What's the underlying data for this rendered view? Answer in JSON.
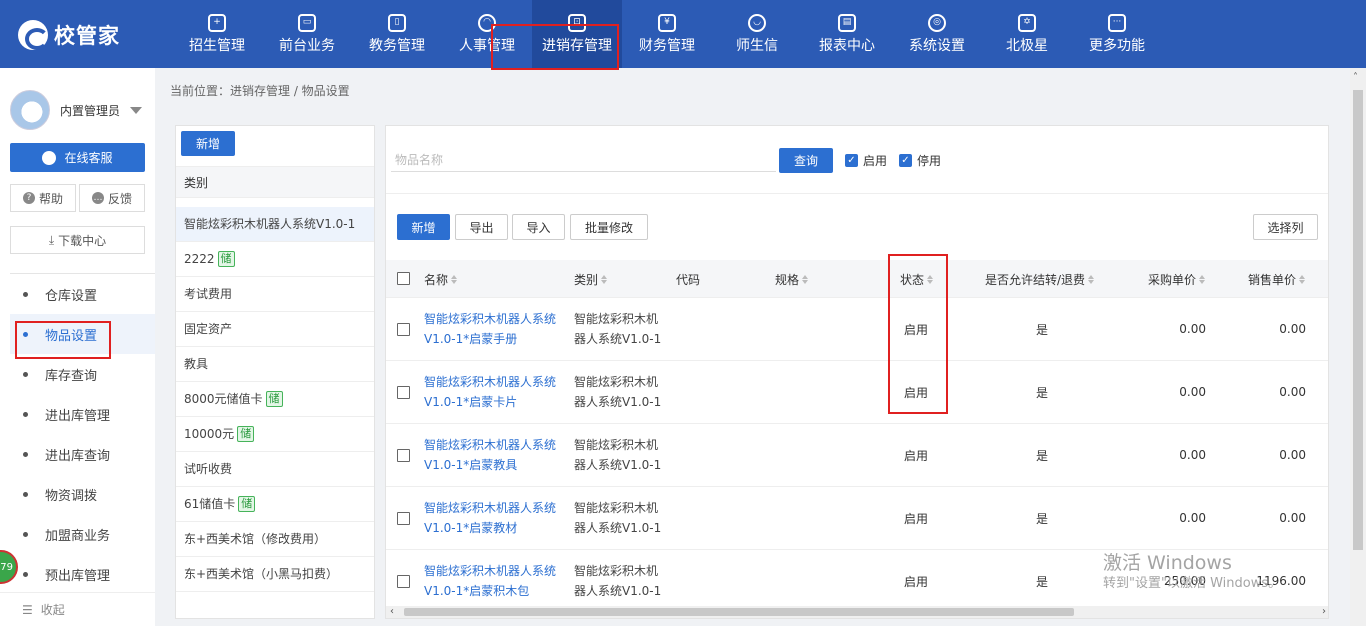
{
  "app": {
    "logo_text": "校管家"
  },
  "nav": [
    {
      "label": "招生管理",
      "icon": "person-add-icon"
    },
    {
      "label": "前台业务",
      "icon": "reception-icon"
    },
    {
      "label": "教务管理",
      "icon": "book-icon"
    },
    {
      "label": "人事管理",
      "icon": "user-icon"
    },
    {
      "label": "进销存管理",
      "icon": "inventory-icon",
      "active": true
    },
    {
      "label": "财务管理",
      "icon": "yen-icon"
    },
    {
      "label": "师生信",
      "icon": "message-icon"
    },
    {
      "label": "报表中心",
      "icon": "report-icon"
    },
    {
      "label": "系统设置",
      "icon": "settings-icon"
    },
    {
      "label": "北极星",
      "icon": "star-icon"
    },
    {
      "label": "更多功能",
      "icon": "more-icon"
    }
  ],
  "nav_glyphs": [
    "+",
    "▭",
    "▯",
    "◠",
    "⊡",
    "¥",
    "◡",
    "▤",
    "◎",
    "✡",
    "···"
  ],
  "user": {
    "name": "内置管理员"
  },
  "sidebar": {
    "online_service": "在线客服",
    "help": "帮助",
    "feedback": "反馈",
    "download_center": "下载中心",
    "menu": [
      "仓库设置",
      "物品设置",
      "库存查询",
      "进出库管理",
      "进出库查询",
      "物资调拨",
      "加盟商业务",
      "预出库管理"
    ],
    "active_index": 1,
    "collapse": "收起",
    "float_badge": "79"
  },
  "breadcrumb": "当前位置：进销存管理 / 物品设置",
  "category_panel": {
    "add_button": "新增",
    "header": "类别",
    "items": [
      {
        "name": "智能炫彩积木机器人系统V1.0-1",
        "tag": ""
      },
      {
        "name": "2222",
        "tag": "储"
      },
      {
        "name": "考试费用",
        "tag": ""
      },
      {
        "name": "固定资产",
        "tag": ""
      },
      {
        "name": "教具",
        "tag": ""
      },
      {
        "name": "8000元储值卡",
        "tag": "储"
      },
      {
        "name": "10000元",
        "tag": "储"
      },
      {
        "name": "试听收费",
        "tag": ""
      },
      {
        "name": "61储值卡",
        "tag": "储"
      },
      {
        "name": "东+西美术馆（修改费用）",
        "tag": ""
      },
      {
        "name": "东+西美术馆（小黑马扣费）",
        "tag": ""
      }
    ]
  },
  "search": {
    "placeholder": "物品名称",
    "query_button": "查询",
    "filter_enabled": "启用",
    "filter_disabled": "停用"
  },
  "toolbar": {
    "add": "新增",
    "export": "导出",
    "import": "导入",
    "batch_edit": "批量修改",
    "select_columns": "选择列"
  },
  "table": {
    "columns": [
      "名称",
      "类别",
      "代码",
      "规格",
      "状态",
      "是否允许结转/退费",
      "采购单价",
      "销售单价"
    ],
    "rows": [
      {
        "name": "智能炫彩积木机器人系统V1.0-1*启蒙手册",
        "category": "智能炫彩积木机器人系统V1.0-1",
        "code": "",
        "spec": "",
        "status": "启用",
        "transfer": "是",
        "purchase_price": "0.00",
        "sale_price": "0.00"
      },
      {
        "name": "智能炫彩积木机器人系统V1.0-1*启蒙卡片",
        "category": "智能炫彩积木机器人系统V1.0-1",
        "code": "",
        "spec": "",
        "status": "启用",
        "transfer": "是",
        "purchase_price": "0.00",
        "sale_price": "0.00"
      },
      {
        "name": "智能炫彩积木机器人系统V1.0-1*启蒙教具",
        "category": "智能炫彩积木机器人系统V1.0-1",
        "code": "",
        "spec": "",
        "status": "启用",
        "transfer": "是",
        "purchase_price": "0.00",
        "sale_price": "0.00"
      },
      {
        "name": "智能炫彩积木机器人系统V1.0-1*启蒙教材",
        "category": "智能炫彩积木机器人系统V1.0-1",
        "code": "",
        "spec": "",
        "status": "启用",
        "transfer": "是",
        "purchase_price": "0.00",
        "sale_price": "0.00"
      },
      {
        "name": "智能炫彩积木机器人系统V1.0-1*启蒙积木包",
        "category": "智能炫彩积木机器人系统V1.0-1",
        "code": "",
        "spec": "",
        "status": "启用",
        "transfer": "是",
        "purchase_price": "250.00",
        "sale_price": "1196.00"
      }
    ]
  },
  "watermark": {
    "line1": "激活 Windows",
    "line2": "转到\"设置\"以激活 Windows。"
  },
  "colors": {
    "brand": "#2c5bb5",
    "accent": "#2c6fd1",
    "highlight": "#e02020",
    "tag_green": "#46b35a"
  }
}
